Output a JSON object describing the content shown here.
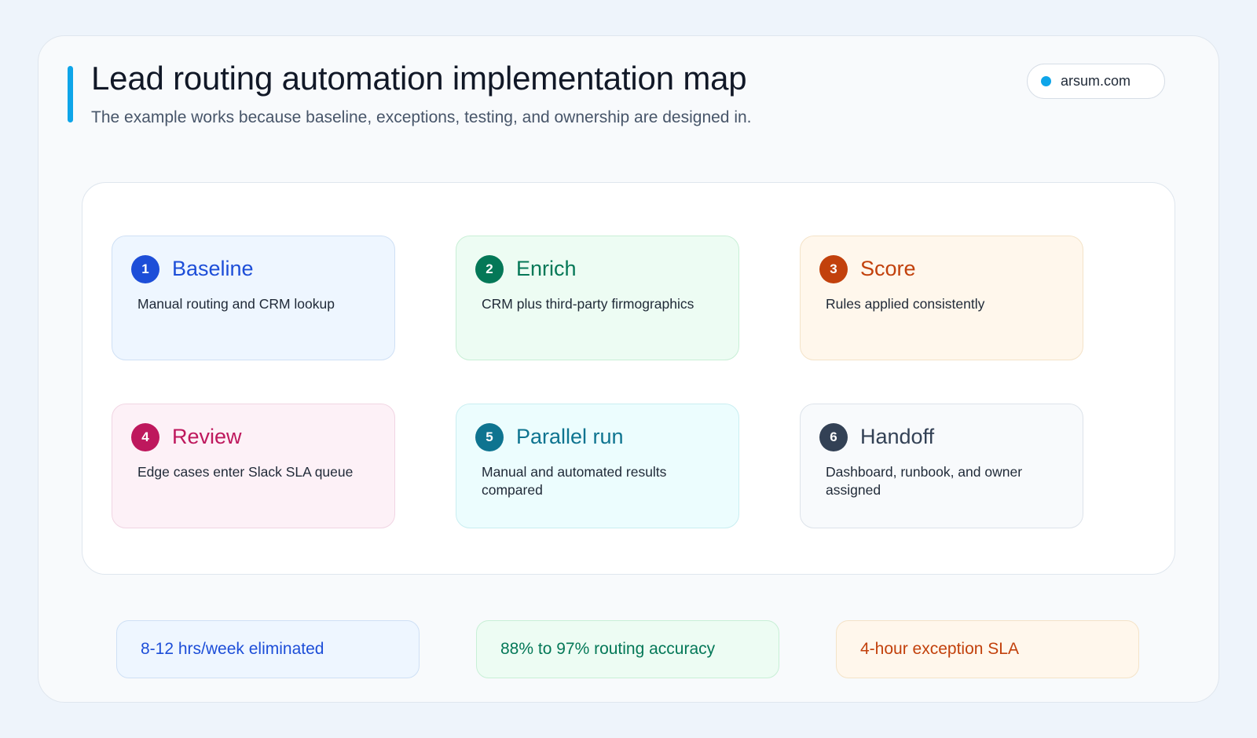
{
  "header": {
    "title": "Lead routing automation implementation map",
    "subtitle": "The example works because baseline, exceptions, testing, and ownership are designed in.",
    "badge": "arsum.com"
  },
  "steps": [
    {
      "number": "1",
      "title": "Baseline",
      "description": "Manual routing and CRM lookup",
      "color": "#1d4ed8"
    },
    {
      "number": "2",
      "title": "Enrich",
      "description": "CRM plus third-party firmographics",
      "color": "#047857"
    },
    {
      "number": "3",
      "title": "Score",
      "description": "Rules applied consistently",
      "color": "#c2410c"
    },
    {
      "number": "4",
      "title": "Review",
      "description": "Edge cases enter Slack SLA queue",
      "color": "#be185d"
    },
    {
      "number": "5",
      "title": "Parallel run",
      "description": "Manual and automated results compared",
      "color": "#0e7490"
    },
    {
      "number": "6",
      "title": "Handoff",
      "description": "Dashboard, runbook, and owner assigned",
      "color": "#334155"
    }
  ],
  "metrics": [
    {
      "label": "8-12 hrs/week eliminated",
      "color": "#1d4ed8"
    },
    {
      "label": "88% to 97% routing accuracy",
      "color": "#047857"
    },
    {
      "label": "4-hour exception SLA",
      "color": "#c2410c"
    }
  ],
  "accent_color": "#0ea5e9"
}
